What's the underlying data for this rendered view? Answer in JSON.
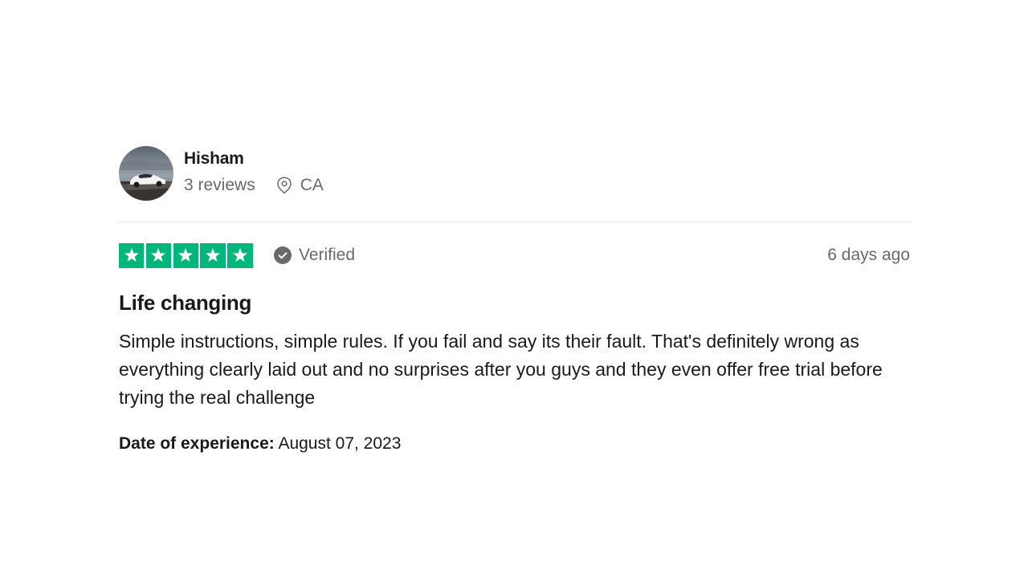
{
  "consumer": {
    "name": "Hisham",
    "reviews_count": "3 reviews",
    "location": "CA",
    "avatar_icon": "car-photo-avatar"
  },
  "review": {
    "rating": 5,
    "rating_max": 5,
    "star_color": "#00b67a",
    "verified_label": "Verified",
    "posted": "6 days ago",
    "title": "Life changing",
    "body": "Simple instructions, simple rules. If you fail and say its their fault. That's definitely wrong as everything clearly laid out and no surprises after you guys and they even offer free trial before trying the real challenge",
    "experience_label": "Date of experience:",
    "experience_date": "August 07, 2023"
  }
}
